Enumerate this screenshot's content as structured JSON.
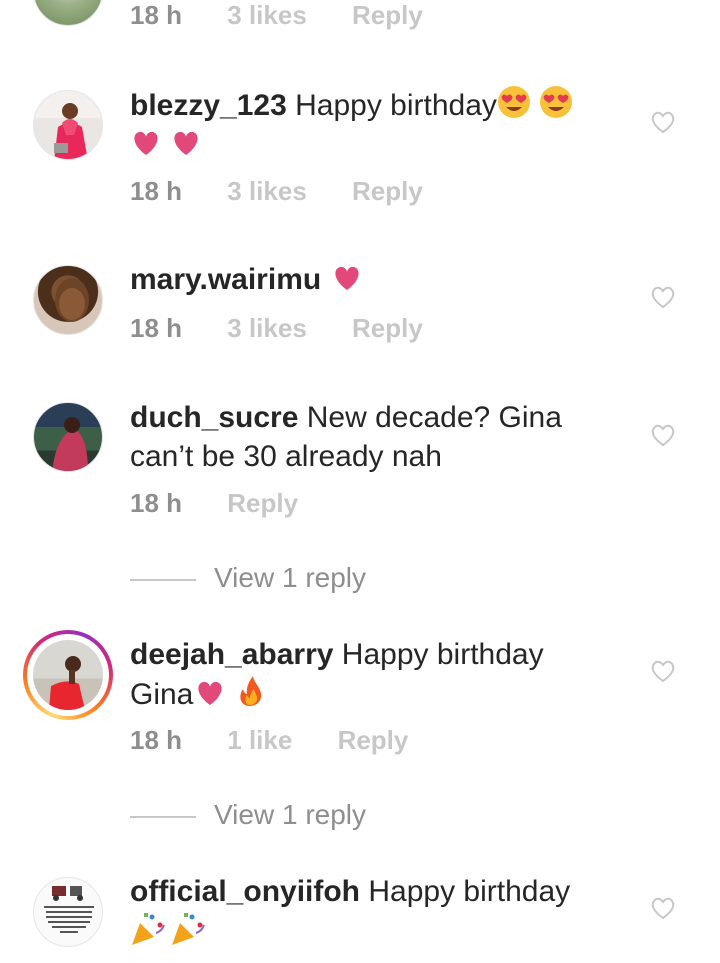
{
  "comments": [
    {
      "id": "top",
      "username": "",
      "text": "",
      "time": "18 h",
      "likes": "3 likes",
      "reply": "Reply"
    },
    {
      "id": "blezzy",
      "username": "blezzy_123",
      "text": "Happy birthday",
      "emojis": [
        "heart-eyes-emoji",
        "heart-eyes-emoji",
        "heart-emoji",
        "heart-emoji"
      ],
      "time": "18 h",
      "likes": "3 likes",
      "reply": "Reply"
    },
    {
      "id": "mary",
      "username": "mary.wairimu",
      "text": "",
      "emojis": [
        "heart-emoji"
      ],
      "time": "18 h",
      "likes": "3 likes",
      "reply": "Reply"
    },
    {
      "id": "duch",
      "username": "duch_sucre",
      "text": "New decade? Gina can’t be 30 already nah",
      "time": "18 h",
      "reply": "Reply",
      "view_replies": "View 1 reply"
    },
    {
      "id": "deejah",
      "username": "deejah_abarry",
      "text": "Happy birthday Gina",
      "emojis": [
        "heart-emoji",
        "fire-emoji"
      ],
      "time": "18 h",
      "likes": "1 like",
      "reply": "Reply",
      "view_replies": "View 1 reply"
    },
    {
      "id": "onyi",
      "username": "official_onyiifoh",
      "text": "Happy birthday",
      "emojis": [
        "party-popper-emoji",
        "party-popper-emoji"
      ],
      "avatar_text": "If money and material things make you believe you are better than others, you are the poorest person on earth."
    }
  ],
  "colors": {
    "username": "#262626",
    "meta": "#8e8e8e",
    "meta_light": "#c7c7c7",
    "heart_emoji": "#e2487a",
    "like_icon": "#c7c7c7"
  }
}
